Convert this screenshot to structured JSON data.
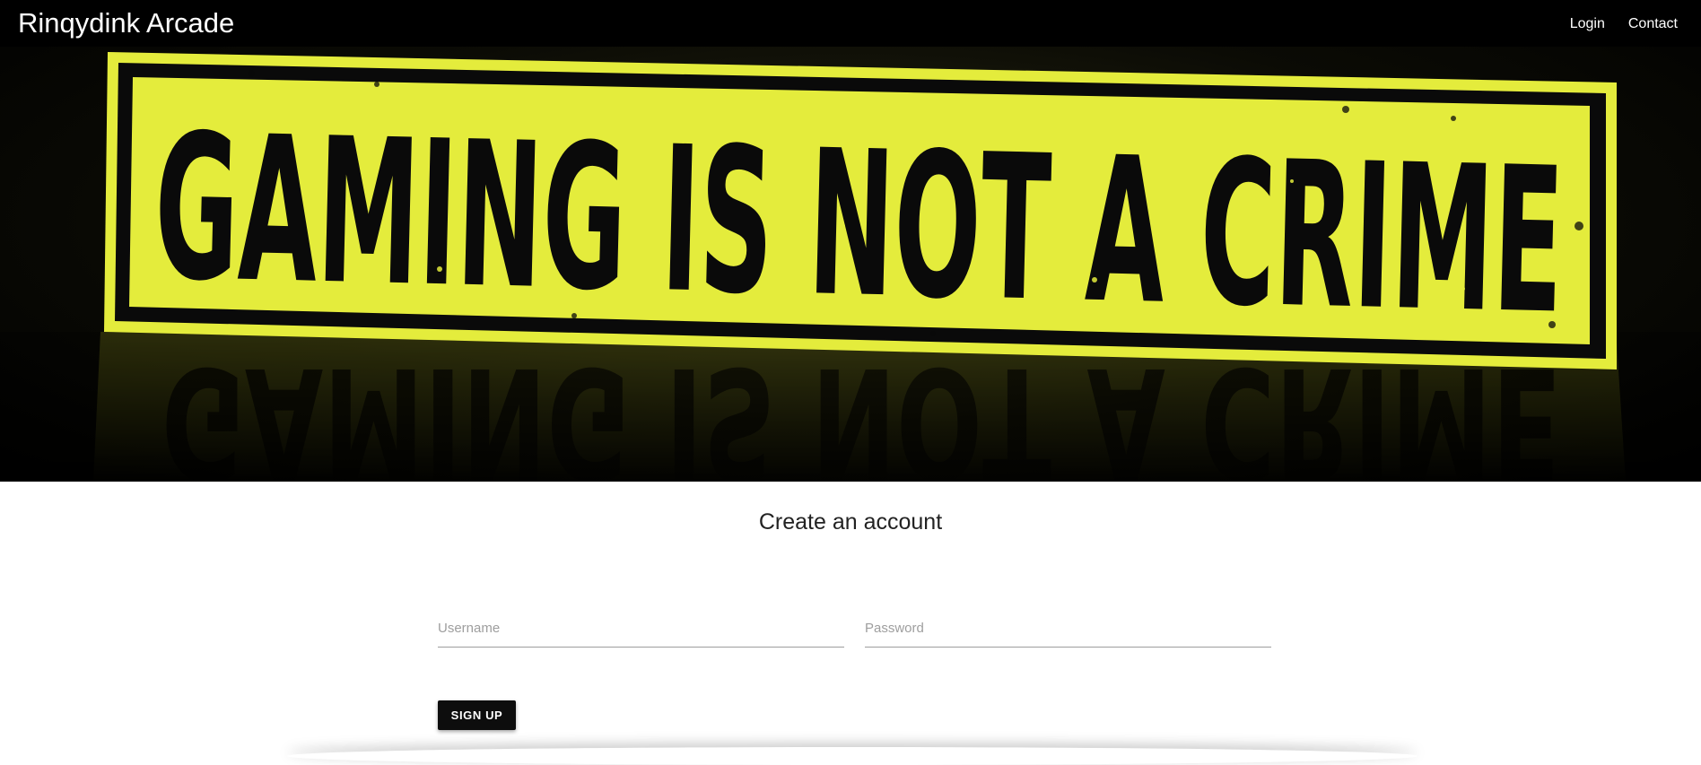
{
  "navbar": {
    "brand": "Rinqydink Arcade",
    "links": [
      "Login",
      "Contact"
    ]
  },
  "hero": {
    "banner_text": "GAMING IS NOT A CRIME",
    "colors": {
      "tape": "#e4ec3c",
      "ink": "#0a0a0a",
      "background": "#000000"
    }
  },
  "form": {
    "title": "Create an account",
    "username_placeholder": "Username",
    "password_placeholder": "Password",
    "submit_label": "SIGN UP"
  }
}
